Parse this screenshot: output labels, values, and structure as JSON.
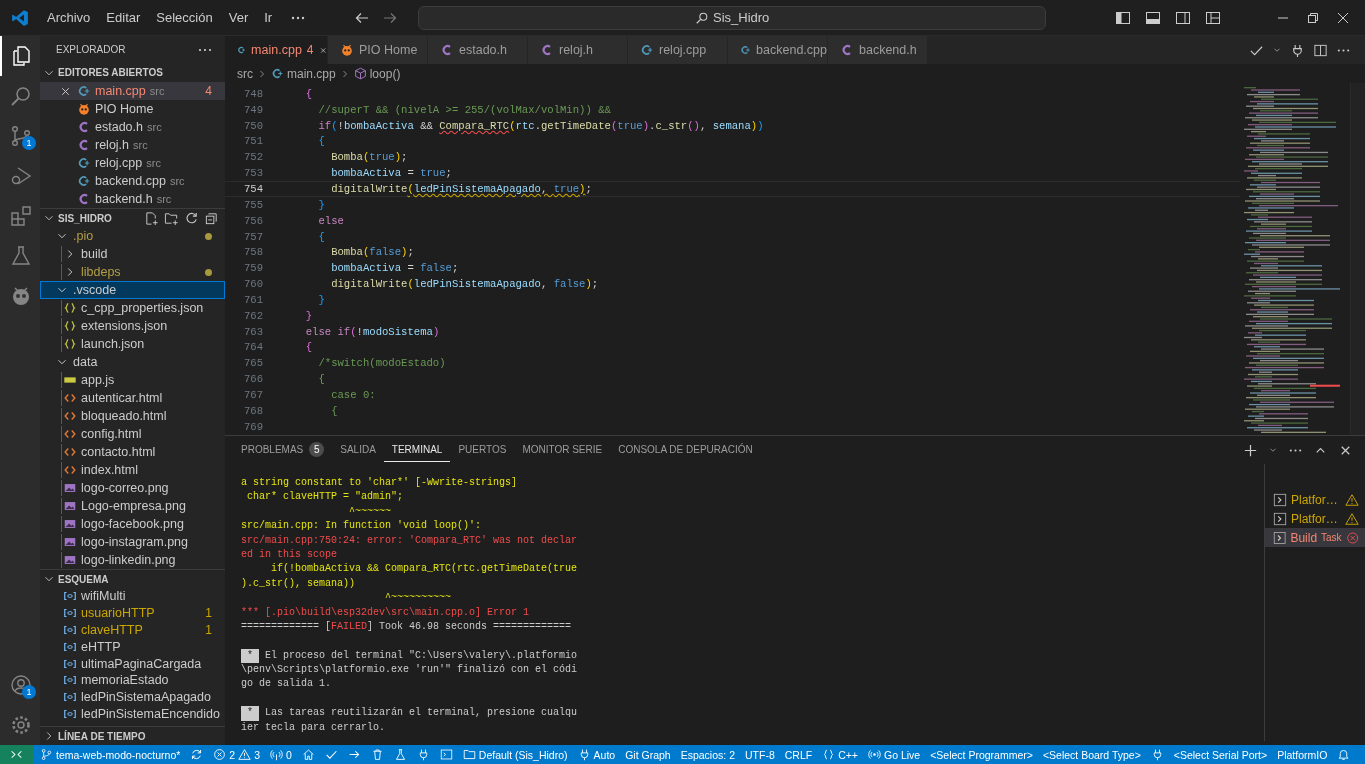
{
  "title_bar": {
    "menu": [
      "Archivo",
      "Editar",
      "Selección",
      "Ver",
      "Ir"
    ],
    "command_center": "Sis_Hidro"
  },
  "activity_bar": {
    "top": [
      {
        "kind": "explorer",
        "selected": true
      },
      {
        "kind": "search",
        "selected": false
      },
      {
        "kind": "source-control",
        "selected": false,
        "badge": "1"
      },
      {
        "kind": "run",
        "selected": false
      },
      {
        "kind": "extensions",
        "selected": false
      },
      {
        "kind": "testing",
        "selected": false
      },
      {
        "kind": "platformio",
        "selected": false
      }
    ],
    "bottom": [
      {
        "kind": "account",
        "badge": "1"
      },
      {
        "kind": "settings"
      }
    ]
  },
  "sidebar": {
    "title": "EXPLORADOR",
    "open_editors": {
      "title": "EDITORES ABIERTOS",
      "expanded": true,
      "items": [
        {
          "label": "main.cpp",
          "kind": "cpp",
          "description": "src",
          "badge": "4",
          "error": true,
          "selected": true
        },
        {
          "label": "PIO Home",
          "kind": "pio",
          "error": false,
          "selected": false
        },
        {
          "label": "estado.h",
          "kind": "c",
          "description": "src",
          "error": false,
          "selected": false
        },
        {
          "label": "reloj.h",
          "kind": "c",
          "description": "src",
          "error": false,
          "selected": false
        },
        {
          "label": "reloj.cpp",
          "kind": "cpp",
          "description": "src",
          "error": false,
          "selected": false
        },
        {
          "label": "backend.cpp",
          "kind": "cpp",
          "description": "src",
          "error": false,
          "selected": false
        },
        {
          "label": "backend.h",
          "kind": "c",
          "description": "src",
          "error": false,
          "selected": false
        }
      ]
    },
    "folder": {
      "title": "SIS_HIDRO",
      "expanded": true,
      "tree": [
        {
          "label": ".pio",
          "kind": "folder",
          "expanded": true,
          "modified": true,
          "selected": false,
          "children": [
            {
              "label": "build",
              "kind": "folder",
              "expanded": false,
              "modified": false,
              "selected": false
            },
            {
              "label": "libdeps",
              "kind": "folder",
              "expanded": false,
              "modified": true,
              "selected": false
            }
          ]
        },
        {
          "label": ".vscode",
          "kind": "folder",
          "expanded": true,
          "modified": false,
          "selected": true,
          "children": [
            {
              "label": "c_cpp_properties.json",
              "kind": "json",
              "modified": false,
              "selected": false
            },
            {
              "label": "extensions.json",
              "kind": "json",
              "modified": false,
              "selected": false
            },
            {
              "label": "launch.json",
              "kind": "json",
              "modified": false,
              "selected": false
            }
          ]
        },
        {
          "label": "data",
          "kind": "folder",
          "expanded": true,
          "modified": false,
          "selected": false,
          "children": [
            {
              "label": "app.js",
              "kind": "js",
              "modified": false,
              "selected": false
            },
            {
              "label": "autenticar.html",
              "kind": "html",
              "modified": false,
              "selected": false
            },
            {
              "label": "bloqueado.html",
              "kind": "html",
              "modified": false,
              "selected": false
            },
            {
              "label": "config.html",
              "kind": "html",
              "modified": false,
              "selected": false
            },
            {
              "label": "contacto.html",
              "kind": "html",
              "modified": false,
              "selected": false
            },
            {
              "label": "index.html",
              "kind": "html",
              "modified": false,
              "selected": false
            },
            {
              "label": "logo-correo.png",
              "kind": "image",
              "modified": false,
              "selected": false
            },
            {
              "label": "Logo-empresa.png",
              "kind": "image",
              "modified": false,
              "selected": false
            },
            {
              "label": "logo-facebook.png",
              "kind": "image",
              "modified": false,
              "selected": false
            },
            {
              "label": "logo-instagram.png",
              "kind": "image",
              "modified": false,
              "selected": false
            },
            {
              "label": "logo-linkedin.png",
              "kind": "image",
              "modified": false,
              "selected": false
            }
          ]
        }
      ]
    },
    "outline": {
      "title": "ESQUEMA",
      "expanded": true,
      "items": [
        {
          "label": "wifiMulti",
          "warning": false,
          "selected": false
        },
        {
          "label": "usuarioHTTP",
          "badge": "1",
          "warning": true,
          "selected": false
        },
        {
          "label": "claveHTTP",
          "badge": "1",
          "warning": true,
          "selected": false
        },
        {
          "label": "eHTTP",
          "warning": false,
          "selected": false
        },
        {
          "label": "ultimaPaginaCargada",
          "warning": false,
          "selected": false
        },
        {
          "label": "memoriaEstado",
          "warning": false,
          "selected": false
        },
        {
          "label": "ledPinSistemaApagado",
          "warning": false,
          "selected": false
        },
        {
          "label": "ledPinSistemaEncendido",
          "warning": false,
          "selected": false
        }
      ]
    },
    "timeline": {
      "title": "LÍNEA DE TIEMPO",
      "expanded": false
    }
  },
  "editor": {
    "tabs": [
      {
        "label": "main.cpp",
        "kind": "cpp",
        "badge": "4",
        "error": true,
        "selected": true
      },
      {
        "label": "PIO Home",
        "kind": "pio",
        "error": false,
        "selected": false
      },
      {
        "label": "estado.h",
        "kind": "c",
        "error": false,
        "selected": false
      },
      {
        "label": "reloj.h",
        "kind": "c",
        "error": false,
        "selected": false
      },
      {
        "label": "reloj.cpp",
        "kind": "cpp",
        "error": false,
        "selected": false
      },
      {
        "label": "backend.cpp",
        "kind": "cpp",
        "error": false,
        "selected": false
      },
      {
        "label": "backend.h",
        "kind": "c",
        "error": false,
        "selected": false
      }
    ],
    "breadcrumbs": [
      {
        "label": "src",
        "kind": "folder"
      },
      {
        "label": "main.cpp",
        "kind": "cpp"
      },
      {
        "label": "loop()",
        "kind": "method"
      }
    ],
    "lines": [
      {
        "n": "748",
        "current": false,
        "tokens": [
          {
            "text": "  {",
            "kind": "b2"
          }
        ]
      },
      {
        "n": "749",
        "current": false,
        "tokens": [
          {
            "text": "    //superT && (nivelA >= 255/(volMax/volMin)) &&",
            "kind": "cm"
          }
        ]
      },
      {
        "n": "750",
        "current": false,
        "tokens": [
          {
            "text": "    if",
            "kind": "kw"
          },
          {
            "text": "(",
            "kind": "b3"
          },
          {
            "text": "!",
            "kind": "p"
          },
          {
            "text": "bombaActiva",
            "kind": "var"
          },
          {
            "text": " && ",
            "kind": "p"
          },
          {
            "text": "Compara_RTC",
            "kind": "fn",
            "error": true
          },
          {
            "text": "(",
            "kind": "b1"
          },
          {
            "text": "rtc",
            "kind": "var"
          },
          {
            "text": ".",
            "kind": "p"
          },
          {
            "text": "getTimeDate",
            "kind": "fn"
          },
          {
            "text": "(",
            "kind": "b2"
          },
          {
            "text": "true",
            "kind": "const"
          },
          {
            "text": ")",
            "kind": "b2"
          },
          {
            "text": ".",
            "kind": "p"
          },
          {
            "text": "c_str",
            "kind": "fn"
          },
          {
            "text": "()",
            "kind": "b2"
          },
          {
            "text": ", ",
            "kind": "p"
          },
          {
            "text": "semana",
            "kind": "var"
          },
          {
            "text": ")",
            "kind": "b1"
          },
          {
            "text": ")",
            "kind": "b3"
          }
        ]
      },
      {
        "n": "751",
        "current": false,
        "tokens": [
          {
            "text": "    {",
            "kind": "b3"
          }
        ]
      },
      {
        "n": "752",
        "current": false,
        "tokens": [
          {
            "text": "      Bomba",
            "kind": "fn"
          },
          {
            "text": "(",
            "kind": "b1"
          },
          {
            "text": "true",
            "kind": "const"
          },
          {
            "text": ")",
            "kind": "b1"
          },
          {
            "text": ";",
            "kind": "p"
          }
        ]
      },
      {
        "n": "753",
        "current": false,
        "tokens": [
          {
            "text": "      bombaActiva",
            "kind": "var"
          },
          {
            "text": " = ",
            "kind": "p"
          },
          {
            "text": "true",
            "kind": "const"
          },
          {
            "text": ";",
            "kind": "p"
          }
        ]
      },
      {
        "n": "754",
        "current": true,
        "tokens": [
          {
            "text": "      digitalWrite",
            "kind": "fn"
          },
          {
            "text": "(",
            "kind": "b1",
            "warning": true
          },
          {
            "text": "ledPinSistemaApagado",
            "kind": "var",
            "warning": true
          },
          {
            "text": ", ",
            "kind": "p",
            "warning": true
          },
          {
            "text": "true",
            "kind": "const",
            "warning": true
          },
          {
            "text": ")",
            "kind": "b1",
            "warning": true
          },
          {
            "text": ";",
            "kind": "p"
          }
        ]
      },
      {
        "n": "755",
        "current": false,
        "tokens": [
          {
            "text": "    }",
            "kind": "b3"
          }
        ]
      },
      {
        "n": "756",
        "current": false,
        "tokens": [
          {
            "text": "    else",
            "kind": "kw"
          }
        ]
      },
      {
        "n": "757",
        "current": false,
        "tokens": [
          {
            "text": "    {",
            "kind": "b3"
          }
        ]
      },
      {
        "n": "758",
        "current": false,
        "tokens": [
          {
            "text": "      Bomba",
            "kind": "fn"
          },
          {
            "text": "(",
            "kind": "b1"
          },
          {
            "text": "false",
            "kind": "const"
          },
          {
            "text": ")",
            "kind": "b1"
          },
          {
            "text": ";",
            "kind": "p"
          }
        ]
      },
      {
        "n": "759",
        "current": false,
        "tokens": [
          {
            "text": "      bombaActiva",
            "kind": "var"
          },
          {
            "text": " = ",
            "kind": "p"
          },
          {
            "text": "false",
            "kind": "const"
          },
          {
            "text": ";",
            "kind": "p"
          }
        ]
      },
      {
        "n": "760",
        "current": false,
        "tokens": [
          {
            "text": "      digitalWrite",
            "kind": "fn"
          },
          {
            "text": "(",
            "kind": "b1"
          },
          {
            "text": "ledPinSistemaApagado",
            "kind": "var"
          },
          {
            "text": ", ",
            "kind": "p"
          },
          {
            "text": "false",
            "kind": "const"
          },
          {
            "text": ")",
            "kind": "b1"
          },
          {
            "text": ";",
            "kind": "p"
          }
        ]
      },
      {
        "n": "761",
        "current": false,
        "tokens": [
          {
            "text": "    }",
            "kind": "b3"
          }
        ]
      },
      {
        "n": "762",
        "current": false,
        "tokens": [
          {
            "text": "  }",
            "kind": "b2"
          }
        ]
      },
      {
        "n": "763",
        "current": false,
        "tokens": [
          {
            "text": "  else if",
            "kind": "kw"
          },
          {
            "text": "(",
            "kind": "b2"
          },
          {
            "text": "!",
            "kind": "p"
          },
          {
            "text": "modoSistema",
            "kind": "var"
          },
          {
            "text": ")",
            "kind": "b2"
          }
        ]
      },
      {
        "n": "764",
        "current": false,
        "tokens": [
          {
            "text": "  {",
            "kind": "b2"
          }
        ]
      },
      {
        "n": "765",
        "current": false,
        "tokens": [
          {
            "text": "    /*switch(modoEstado)",
            "kind": "cm"
          }
        ]
      },
      {
        "n": "766",
        "current": false,
        "tokens": [
          {
            "text": "    {",
            "kind": "cm"
          }
        ]
      },
      {
        "n": "767",
        "current": false,
        "tokens": [
          {
            "text": "      case 0:",
            "kind": "cm"
          }
        ]
      },
      {
        "n": "768",
        "current": false,
        "tokens": [
          {
            "text": "      {",
            "kind": "cm"
          }
        ]
      },
      {
        "n": "769",
        "current": false
      }
    ]
  },
  "panel": {
    "tabs": [
      {
        "label": "PROBLEMAS",
        "badge": "5",
        "selected": false
      },
      {
        "label": "SALIDA",
        "selected": false
      },
      {
        "label": "TERMINAL",
        "selected": true
      },
      {
        "label": "PUERTOS",
        "selected": false
      },
      {
        "label": "MONITOR SERIE",
        "selected": false
      },
      {
        "label": "CONSOLA DE DEPURACIÓN",
        "selected": false
      }
    ],
    "terminal_lines": [
      [
        {
          "text": "a string constant to 'char*' [-Wwrite-strings]",
          "kind": "warn"
        }
      ],
      [
        {
          "text": " char* claveHTTP = \"admin\";",
          "kind": "warn"
        }
      ],
      [
        {
          "text": "                  ^~~~~~~",
          "kind": "warn"
        }
      ],
      [
        {
          "text": "src/main.cpp: In function 'void loop()':",
          "kind": "warn"
        }
      ],
      [
        {
          "text": "src/main.cpp:750:24: error: 'Compara_RTC' was not declar",
          "kind": "error"
        }
      ],
      [
        {
          "text": "ed in this scope",
          "kind": "error"
        }
      ],
      [
        {
          "text": "     if(!bombaActiva && Compara_RTC(rtc.getTimeDate(true",
          "kind": "warn"
        }
      ],
      [
        {
          "text": ").c_str(), semana))",
          "kind": "warn"
        }
      ],
      [
        {
          "text": "                        ^~~~~~~~~~~",
          "kind": "warn"
        }
      ],
      [
        {
          "text": "*** [.pio\\build\\esp32dev\\src\\main.cpp.o] Error 1",
          "kind": "error"
        }
      ],
      [
        {
          "text": "============= [",
          "kind": "plain"
        },
        {
          "text": "FAILED",
          "kind": "error"
        },
        {
          "text": "] Took 46.98 seconds =============",
          "kind": "plain"
        }
      ],
      [
        {
          "text": "*",
          "kind": "marker"
        },
        {
          "text": " El proceso del terminal \"C:\\Users\\valery\\.platformio",
          "kind": "plain"
        }
      ],
      [
        {
          "text": "\\penv\\Scripts\\platformio.exe 'run'\" finalizó con el códi",
          "kind": "plain"
        }
      ],
      [
        {
          "text": "go de salida 1.",
          "kind": "plain"
        }
      ],
      [
        {
          "text": "*",
          "kind": "marker"
        },
        {
          "text": " Las tareas reutilizarán el terminal, presione cualqu",
          "kind": "plain"
        }
      ],
      [
        {
          "text": "ier tecla para cerrarlo.",
          "kind": "plain"
        }
      ]
    ],
    "terminals": [
      {
        "label": "Platfor…",
        "kind": "warning",
        "selected": false
      },
      {
        "label": "Platfor…",
        "kind": "warning",
        "selected": false
      },
      {
        "label": "Build",
        "description": "Task",
        "kind": "error",
        "selected": true
      }
    ]
  },
  "status_bar": [
    {
      "kind": "remote"
    },
    {
      "kind": "branch",
      "label": "tema-web-modo-nocturno*"
    },
    {
      "kind": "sync"
    },
    {
      "kind": "problems",
      "errors": "2",
      "warnings": "3"
    },
    {
      "kind": "antenna",
      "label": "0"
    },
    {
      "kind": "home"
    },
    {
      "kind": "check"
    },
    {
      "kind": "arrow"
    },
    {
      "kind": "trash"
    },
    {
      "kind": "flask"
    },
    {
      "kind": "plug"
    },
    {
      "kind": "terminal"
    },
    {
      "kind": "folder",
      "label": "Default (Sis_Hidro)"
    },
    {
      "kind": "plug",
      "label": "Auto"
    },
    {
      "kind": "text",
      "label": "Git Graph"
    },
    {
      "kind": "text",
      "label": "Espacios: 2"
    },
    {
      "kind": "text",
      "label": "UTF-8"
    },
    {
      "kind": "text",
      "label": "CRLF"
    },
    {
      "kind": "braces",
      "label": "C++"
    },
    {
      "kind": "radio",
      "label": "Go Live"
    },
    {
      "kind": "text",
      "label": "<Select Programmer>"
    },
    {
      "kind": "text",
      "label": "<Select Board Type>"
    },
    {
      "kind": "plug"
    },
    {
      "kind": "text",
      "label": "<Select Serial Port>"
    },
    {
      "kind": "text",
      "label": "PlatformIO"
    },
    {
      "kind": "bell"
    }
  ]
}
